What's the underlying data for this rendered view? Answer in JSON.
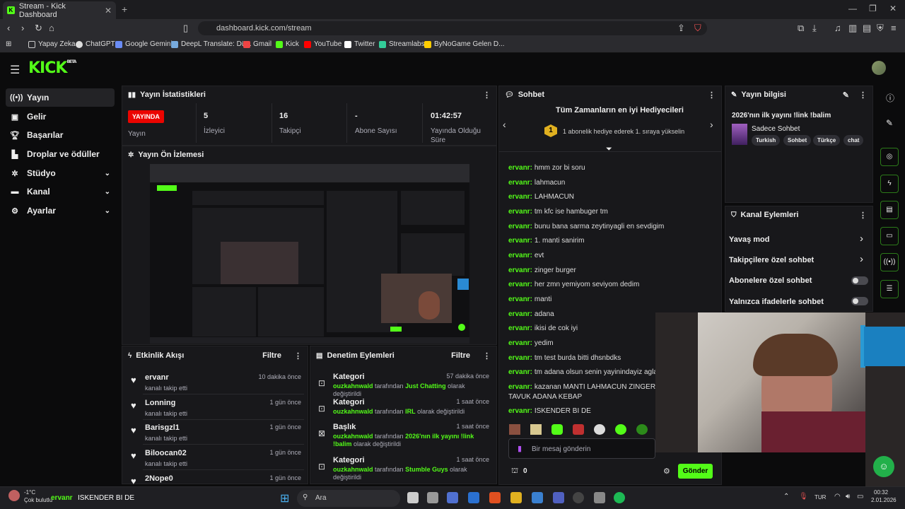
{
  "browser": {
    "tab_title": "Stream - Kick Dashboard",
    "url": "dashboard.kick.com/stream",
    "bookmarks": [
      "Yapay Zeka",
      "ChatGPT",
      "Google Gemini",
      "DeepL Translate: Dü...",
      "Gmail",
      "Kick",
      "YouTube",
      "Twitter",
      "Streamlabs",
      "ByNoGame Gelen D..."
    ]
  },
  "app": {
    "logo": "KICK",
    "logo_badge": "BETA"
  },
  "sidebar": [
    {
      "label": "Yayın",
      "icon": "stream-icon"
    },
    {
      "label": "Gelir",
      "icon": "revenue-icon"
    },
    {
      "label": "Başarılar",
      "icon": "trophy-icon"
    },
    {
      "label": "Droplar ve ödüller",
      "icon": "drops-icon"
    },
    {
      "label": "Stüdyo",
      "icon": "studio-icon"
    },
    {
      "label": "Kanal",
      "icon": "channel-icon"
    },
    {
      "label": "Ayarlar",
      "icon": "settings-icon"
    }
  ],
  "stats": {
    "title": "Yayın İstatistikleri",
    "live_badge": "YAYINDA",
    "status_label": "Yayın",
    "items": [
      {
        "value": "5",
        "label": "İzleyici"
      },
      {
        "value": "16",
        "label": "Takipçi"
      },
      {
        "value": "-",
        "label": "Abone Sayısı"
      },
      {
        "value": "01:42:57",
        "label": "Yayında Olduğu Süre"
      }
    ]
  },
  "preview": {
    "title": "Yayın Ön İzlemesi"
  },
  "activity": {
    "title": "Etkinlik Akışı",
    "filter": "Filtre",
    "items": [
      {
        "name": "ervanr",
        "sub": "kanalı takip etti",
        "time": "10 dakika önce"
      },
      {
        "name": "Lonning",
        "sub": "kanalı takip etti",
        "time": "1 gün önce"
      },
      {
        "name": "Barisgzl1",
        "sub": "kanalı takip etti",
        "time": "1 gün önce"
      },
      {
        "name": "Biloocan02",
        "sub": "kanalı takip etti",
        "time": "1 gün önce"
      },
      {
        "name": "2Nope0",
        "sub": "",
        "time": "1 gün önce"
      }
    ]
  },
  "moderation": {
    "title": "Denetim Eylemleri",
    "filter": "Filtre",
    "items": [
      {
        "name": "Kategori",
        "time": "57 dakika önce",
        "user": "ouzkahnwald",
        "mid": "tarafından",
        "value": "Just Chatting",
        "end": "olarak değiştirildi"
      },
      {
        "name": "Kategori",
        "time": "1 saat önce",
        "user": "ouzkahnwald",
        "mid": "tarafından",
        "value": "IRL",
        "end": "olarak değiştirildi"
      },
      {
        "name": "Başlık",
        "time": "1 saat önce",
        "user": "ouzkahnwald",
        "mid": "tarafından",
        "value": "2026'nın ilk yayını !link !balim",
        "end": "olarak değiştirildi"
      },
      {
        "name": "Kategori",
        "time": "1 saat önce",
        "user": "ouzkahnwald",
        "mid": "tarafından",
        "value": "Stumble Guys",
        "end": "olarak değiştirildi"
      }
    ]
  },
  "chat": {
    "title": "Sohbet",
    "gifters_title": "Tüm Zamanların en iyi Hediyecileri",
    "gifters_rank": "1",
    "gifters_text": "1 abonelik hediye ederek 1. sıraya yükselin",
    "messages": [
      {
        "user": "ervanr:",
        "text": "hmm zor bi soru"
      },
      {
        "user": "ervanr:",
        "text": "lahmacun"
      },
      {
        "user": "ervanr:",
        "text": "LAHMACUN"
      },
      {
        "user": "ervanr:",
        "text": "tm kfc ise hambuger tm"
      },
      {
        "user": "ervanr:",
        "text": "bunu bana sarma zeytinyagli en sevdigim"
      },
      {
        "user": "ervanr:",
        "text": "1. manti sanirim"
      },
      {
        "user": "ervanr:",
        "text": "evt"
      },
      {
        "user": "ervanr:",
        "text": "zinger burger"
      },
      {
        "user": "ervanr:",
        "text": "her zmn yemiyom seviyom dedim"
      },
      {
        "user": "ervanr:",
        "text": "manti"
      },
      {
        "user": "ervanr:",
        "text": "adana"
      },
      {
        "user": "ervanr:",
        "text": "ikisi de cok iyi"
      },
      {
        "user": "ervanr:",
        "text": "yedim"
      },
      {
        "user": "ervanr:",
        "text": "tm test burda bitti dhsnbdks"
      },
      {
        "user": "ervanr:",
        "text": "tm adana olsun senin yayinindayiz aglama"
      },
      {
        "user": "ervanr:",
        "text": "kazanan MANTI LAHMACUN ZINGER BURG"
      },
      {
        "user": "",
        "text": "TAVUK ADANA KEBAP"
      },
      {
        "user": "ervanr:",
        "text": "ISKENDER BI DE"
      }
    ],
    "input_placeholder": "Bir mesaj gönderin",
    "points": "0",
    "send": "Gönder"
  },
  "stream_info": {
    "title": "Yayın bilgisi",
    "stream_title": "2026'nın ilk yayını !link !balim",
    "category": "Sadece Sohbet",
    "tags": [
      "Turkish",
      "Sohbet",
      "Türkçe",
      "chat"
    ]
  },
  "channel_actions": {
    "title": "Kanal Eylemleri",
    "items": [
      {
        "label": "Yavaş mod",
        "kind": "chevron"
      },
      {
        "label": "Takipçilere özel sohbet",
        "kind": "chevron"
      },
      {
        "label": "Abonelere özel sohbet",
        "kind": "toggle"
      },
      {
        "label": "Yalnızca ifadelerle sohbet",
        "kind": "toggle"
      }
    ]
  },
  "taskbar": {
    "weather_temp": "-1°C",
    "weather_desc": "Çok bulutlu",
    "notification_user": "ervanr",
    "notification_text": "ISKENDER BI DE",
    "search": "Ara",
    "lang": "TUR",
    "time": "00:32",
    "date": "2.01.2026"
  },
  "colors": {
    "accent": "#53fc18",
    "live": "#eb0400",
    "panel": "#18181b"
  }
}
